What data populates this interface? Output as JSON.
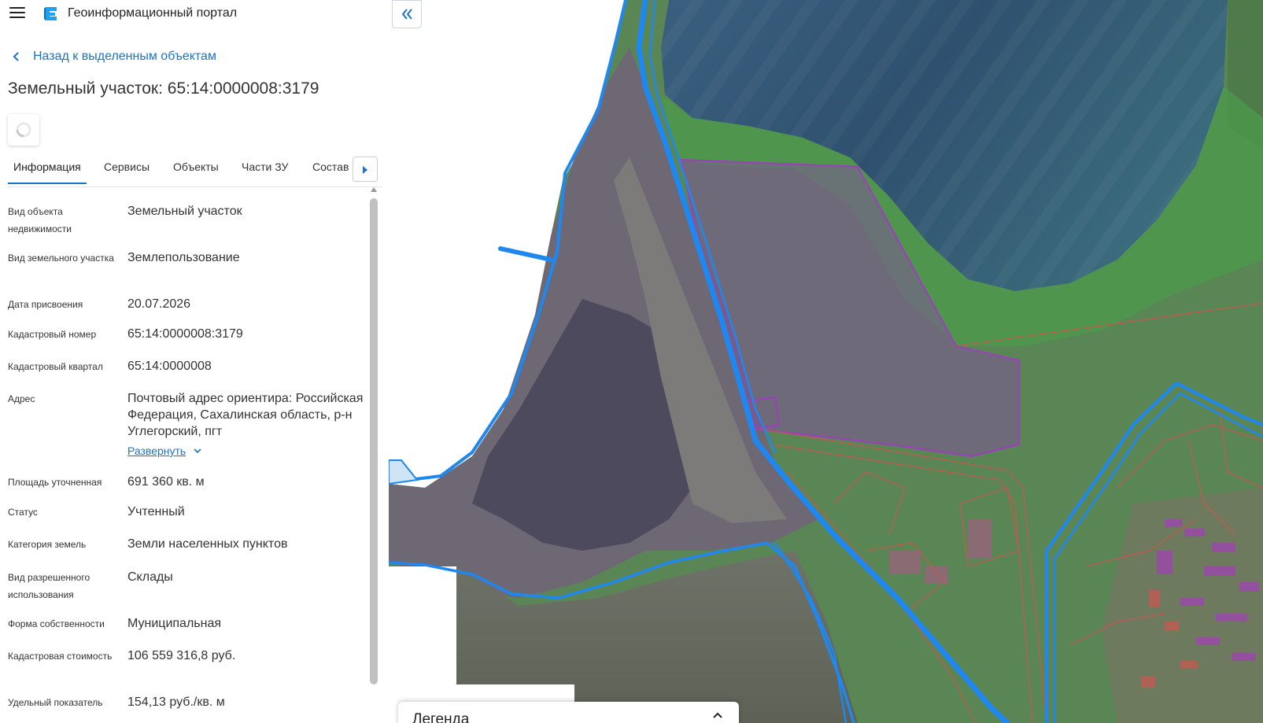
{
  "header": {
    "app_title": "Геоинформационный портал",
    "menu_icon": "hamburger-menu-icon",
    "logo_icon": "portal-logo-icon"
  },
  "panel": {
    "back_link": "Назад к выделенным объектам",
    "title": "Земельный участок: 65:14:0000008:3179",
    "tabs": [
      "Информация",
      "Сервисы",
      "Объекты",
      "Части ЗУ",
      "Состав"
    ],
    "active_tab": "Информация",
    "info": [
      {
        "label": "Вид объекта недвижимости",
        "value": "Земельный участок"
      },
      {
        "label": "Вид земельного участка",
        "value": "Землепользование"
      },
      {
        "label": "Дата присвоения",
        "value": "20.07.2026"
      },
      {
        "label": "Кадастровый номер",
        "value": "65:14:0000008:3179"
      },
      {
        "label": "Кадастровый квартал",
        "value": "65:14:0000008"
      },
      {
        "label": "Адрес",
        "value": "Почтовый адрес ориентира: Российская Федерация, Сахалинская область, р-н Углегорский, пгт",
        "expand_label": "Развернуть"
      },
      {
        "label": "Площадь уточненная",
        "value": "691 360 кв. м"
      },
      {
        "label": "Статус",
        "value": "Учтенный"
      },
      {
        "label": "Категория земель",
        "value": "Земли населенных пунктов"
      },
      {
        "label": "Вид разрешенного использования",
        "value": "Склады"
      },
      {
        "label": "Форма собственности",
        "value": "Муниципальная"
      },
      {
        "label": "Кадастровая стоимость",
        "value": "106 559 316,8 руб."
      },
      {
        "label": "Удельный показатель",
        "value": "154,13 руб./кв. м"
      }
    ]
  },
  "map": {
    "legend_title": "Легенда",
    "colors": {
      "boundary_blue": "#1e88f0",
      "parcel_purple": "#9b3db6",
      "parcel_red": "#d9534f",
      "water": "#2f4f70",
      "land": "#5f8b52",
      "industrial": "#6a6470"
    }
  }
}
